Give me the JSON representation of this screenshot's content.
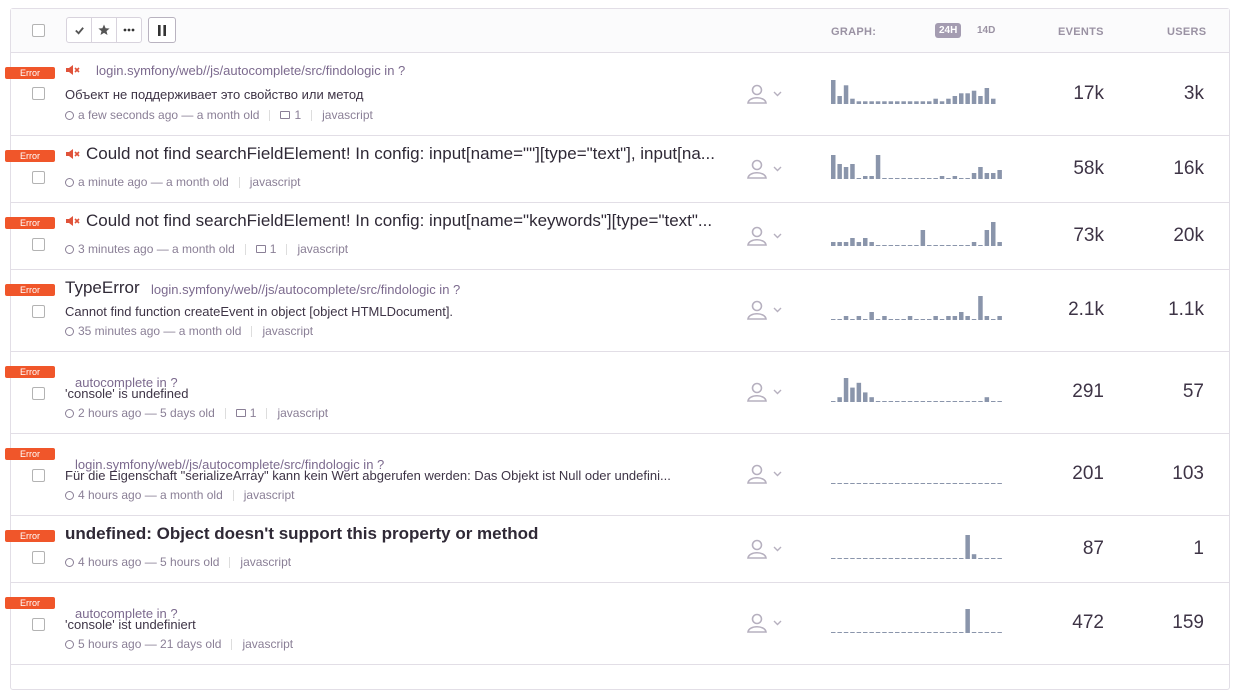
{
  "toolbar": {
    "resolve_icon": "check-icon",
    "bookmark_icon": "star-icon",
    "more_icon": "ellipsis-icon",
    "pause_icon": "pause-icon"
  },
  "header": {
    "graph_label": "GRAPH:",
    "period_24h": "24H",
    "period_14d": "14D",
    "events_label": "EVENTS",
    "users_label": "USERS"
  },
  "colors": {
    "error_badge": "#f0562a",
    "bar": "#8a95ab",
    "active_pill": "#a49cb1"
  },
  "issues": [
    {
      "level": "Error",
      "muted": true,
      "title": "",
      "path": "login.symfony/web//js/autocomplete/src/findologic in ?",
      "message": "Объект не поддерживает это свойство или метод",
      "seen": "a few seconds ago — a month old",
      "comments": "1",
      "platform": "javascript",
      "events": "17k",
      "users": "3k",
      "bars": [
        9,
        3,
        7,
        2,
        1,
        1,
        1,
        1,
        1,
        1,
        1,
        1,
        1,
        1,
        1,
        1,
        2,
        1,
        2,
        3,
        4,
        4,
        5,
        3,
        6,
        2
      ]
    },
    {
      "level": "Error",
      "muted": true,
      "title": "Could not find searchFieldElement! In config: input[name=\"\"][type=\"text\"], input[na...",
      "path": "",
      "message": "",
      "seen": "a minute ago — a month old",
      "comments": "",
      "platform": "javascript",
      "events": "58k",
      "users": "16k",
      "bars": [
        8,
        5,
        4,
        5,
        0,
        1,
        1,
        8,
        0,
        0,
        0,
        0,
        0,
        0,
        0,
        0,
        0,
        1,
        0,
        1,
        0,
        0,
        2,
        4,
        2,
        2,
        3
      ]
    },
    {
      "level": "Error",
      "muted": true,
      "title": "Could not find searchFieldElement! In config: input[name=\"keywords\"][type=\"text\"...",
      "path": "",
      "message": "",
      "seen": "3 minutes ago — a month old",
      "comments": "1",
      "platform": "javascript",
      "events": "73k",
      "users": "20k",
      "bars": [
        1,
        1,
        1,
        2,
        1,
        2,
        1,
        0,
        0,
        0,
        0,
        0,
        0,
        0,
        4,
        0,
        0,
        0,
        0,
        0,
        0,
        0,
        1,
        0,
        4,
        6,
        1
      ]
    },
    {
      "level": "Error",
      "muted": false,
      "title": "TypeError",
      "path": "login.symfony/web//js/autocomplete/src/findologic in ?",
      "message": "Cannot find function createEvent in object [object HTMLDocument].",
      "seen": "35 minutes ago — a month old",
      "comments": "",
      "platform": "javascript",
      "events": "2.1k",
      "users": "1.1k",
      "bars": [
        0,
        0,
        1,
        0,
        1,
        0,
        2,
        0,
        1,
        0,
        0,
        0,
        1,
        0,
        0,
        0,
        1,
        0,
        1,
        1,
        2,
        1,
        0,
        6,
        1,
        0,
        1
      ]
    },
    {
      "level": "Error",
      "muted": false,
      "title": "",
      "path": "autocomplete in ?",
      "message": "'console' is undefined",
      "seen": "2 hours ago — 5 days old",
      "comments": "1",
      "platform": "javascript",
      "events": "291",
      "users": "57",
      "bars": [
        0,
        1,
        5,
        3,
        4,
        2,
        1,
        0,
        0,
        0,
        0,
        0,
        0,
        0,
        0,
        0,
        0,
        0,
        0,
        0,
        0,
        0,
        0,
        0,
        1,
        0,
        0
      ]
    },
    {
      "level": "Error",
      "muted": false,
      "title": "",
      "path": "login.symfony/web//js/autocomplete/src/findologic in ?",
      "message": "Für die Eigenschaft \"serializeArray\" kann kein Wert abgerufen werden: Das Objekt ist Null oder undefini...",
      "seen": "4 hours ago — a month old",
      "comments": "",
      "platform": "javascript",
      "events": "201",
      "users": "103",
      "bars": [
        0,
        0,
        0,
        0,
        0,
        0,
        0,
        0,
        0,
        0,
        0,
        0,
        0,
        0,
        0,
        0,
        0,
        0,
        0,
        0,
        0,
        0,
        0,
        0,
        0,
        0,
        0
      ]
    },
    {
      "level": "Error",
      "muted": false,
      "title": "undefined: Object doesn't support this property or method",
      "path": "",
      "message": "",
      "seen": "4 hours ago — 5 hours old",
      "comments": "",
      "platform": "javascript",
      "events": "87",
      "users": "1",
      "bars": [
        0,
        0,
        0,
        0,
        0,
        0,
        0,
        0,
        0,
        0,
        0,
        0,
        0,
        0,
        0,
        0,
        0,
        0,
        0,
        0,
        0,
        5,
        1,
        0,
        0,
        0,
        0
      ]
    },
    {
      "level": "Error",
      "muted": false,
      "title": "",
      "path": "autocomplete in ?",
      "message": "'console' ist undefiniert",
      "seen": "5 hours ago — 21 days old",
      "comments": "",
      "platform": "javascript",
      "events": "472",
      "users": "159",
      "bars": [
        0,
        0,
        0,
        0,
        0,
        0,
        0,
        0,
        0,
        0,
        0,
        0,
        0,
        0,
        0,
        0,
        0,
        0,
        0,
        0,
        0,
        3,
        0,
        0,
        0,
        0,
        0
      ]
    }
  ]
}
